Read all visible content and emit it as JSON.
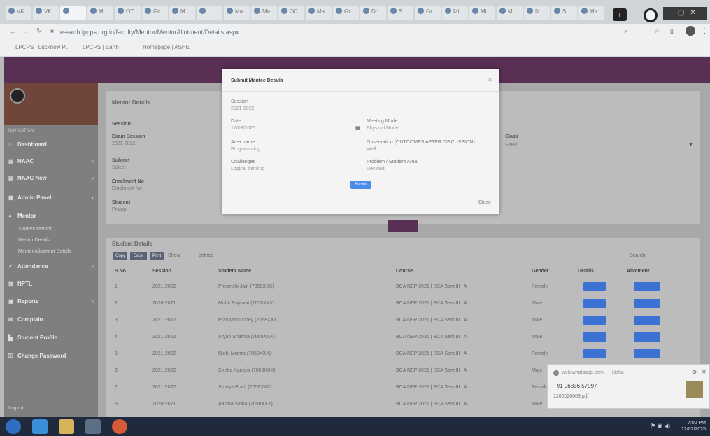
{
  "browser": {
    "tabs": [
      "VK",
      "VK",
      "",
      "Mi",
      "OT",
      "Gc",
      "M",
      "",
      "Ma",
      "Ma",
      "OC",
      "Ma",
      "Gr",
      "Dr",
      "S",
      "Gr",
      "Mi",
      "Mi",
      "Mi",
      "M",
      "S",
      "Ma"
    ],
    "url": "e-earth.lpcps.org.in/faculty/Mentor/MentorAllotment/Details.aspx",
    "bookmarks": [
      "LPCPS | Lucknow P...",
      "LPCPS | Earth",
      "Homepage | ASHE"
    ]
  },
  "sidebar": {
    "section_label": "NAVIGATION",
    "items": [
      {
        "label": "Dashboard",
        "icon": "home-icon"
      },
      {
        "label": "NAAC",
        "icon": "chart-icon"
      },
      {
        "label": "NAAC New",
        "icon": "chart-icon"
      },
      {
        "label": "Admin Panel",
        "icon": "grid-icon"
      },
      {
        "label": "Mentor",
        "icon": "user-icon"
      },
      {
        "label": "Attendance",
        "icon": "check-icon"
      },
      {
        "label": "NPTL",
        "icon": "book-icon"
      },
      {
        "label": "Reports",
        "icon": "file-icon"
      },
      {
        "label": "Complain",
        "icon": "chat-icon"
      },
      {
        "label": "Student Profile",
        "icon": "profile-icon"
      },
      {
        "label": "Change Password",
        "icon": "key-icon"
      }
    ],
    "subitems": [
      "Student Mentor",
      "Mentor Details",
      "Mentor Allotment Details"
    ],
    "footer": "Logout"
  },
  "mentor_panel": {
    "title": "Mentor Details",
    "session_label": "Session",
    "exam_session_label": "Exam Session",
    "exam_session_value": "2021-2022",
    "subject_label": "Subject",
    "subject_value": "Select",
    "enrolment_label": "Enrolment No",
    "enrolment_value": "Enrolment No",
    "student_label": "Student",
    "student_value": "Pratap",
    "class_label": "Class",
    "class_value": "Select"
  },
  "student_panel": {
    "title": "Student Details",
    "buttons": [
      "Copy",
      "Excel",
      "Print"
    ],
    "show_label": "Show",
    "entries_label": "entries",
    "search_label": "Search:",
    "headers": [
      "S.No.",
      "Session",
      "Student Name",
      "Course",
      "Gender",
      "Details",
      "Allotment"
    ],
    "rows": [
      {
        "sno": "1",
        "session": "2021-2022",
        "name": "Priyanshi Jain (7058XXX)",
        "course": "BCA NEP 2021 | BCA Sem III | A",
        "gender": "Female"
      },
      {
        "sno": "2",
        "session": "2020-2021",
        "name": "Mohit Rajawat (7058XXX)",
        "course": "BCA NEP 2021 | BCA Sem III | A",
        "gender": "Male"
      },
      {
        "sno": "3",
        "session": "2021-2022",
        "name": "Prashant Dubey (2058XXX)",
        "course": "BCA NEP 2021 | BCA Sem III | A",
        "gender": "Male"
      },
      {
        "sno": "4",
        "session": "2021-2022",
        "name": "Aryan Sharma (7058XXX)",
        "course": "BCA NEP 2021 | BCA Sem III | A",
        "gender": "Male"
      },
      {
        "sno": "5",
        "session": "2021-2022",
        "name": "Nidhi Mishra (7058XXX)",
        "course": "BCA NEP 2021 | BCA Sem III | A",
        "gender": "Female"
      },
      {
        "sno": "6",
        "session": "2021-2022",
        "name": "Sneha Kanojia (7058XXX)",
        "course": "BCA NEP 2021 | BCA Sem III | A",
        "gender": "Male"
      },
      {
        "sno": "7",
        "session": "2021-2022",
        "name": "Shreya Bhatt (7058XXX)",
        "course": "BCA NEP 2021 | BCA Sem III | A",
        "gender": "Female"
      },
      {
        "sno": "8",
        "session": "2020-2021",
        "name": "Aastha Sinha (7058XXX)",
        "course": "BCA NEP 2021 | BCA Sem III | A",
        "gender": "Male"
      }
    ]
  },
  "modal": {
    "title": "Submit Mentee Details",
    "session_label": "Session",
    "session_value": "2021-2022",
    "date_label": "Date",
    "date_value": "17/09/2025",
    "meeting_mode_label": "Meeting Mode",
    "meeting_mode_value": "Physical Mode",
    "areas_label": "Area name",
    "areas_value": "Programming",
    "observation_label": "Observation (OUTCOMES AFTER DISCUSSION)",
    "observation_value": "Well",
    "challenges_label": "Challenges",
    "challenges_value": "Logical thinking",
    "problem_label": "Problem / Student Area",
    "problem_value": "Decided",
    "submit": "Submit",
    "close": "Close"
  },
  "notification": {
    "source": "web.whatsapp.com",
    "sender": "Neha",
    "phone": "+91 96336 57997",
    "text": "1200020008.pdf"
  },
  "taskbar": {
    "time": "7:00 PM",
    "date": "12/02/2025"
  },
  "colors": {
    "brand": "#5a2f54",
    "primary_button": "#3b72d4"
  }
}
